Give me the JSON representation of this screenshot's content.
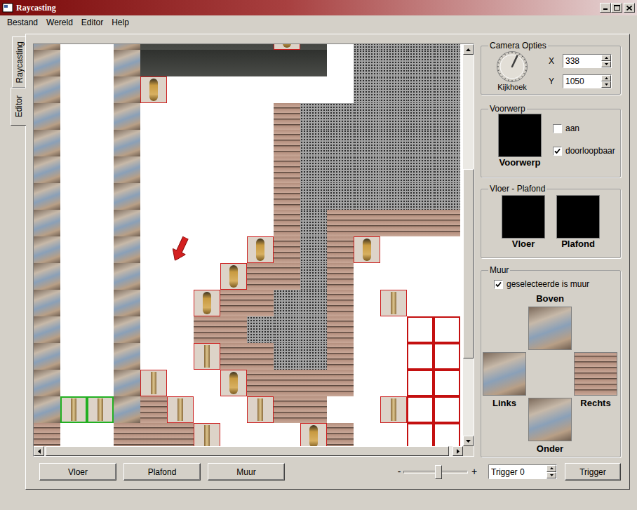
{
  "window": {
    "title": "Raycasting"
  },
  "menu": [
    "Bestand",
    "Wereld",
    "Editor",
    "Help"
  ],
  "side_tabs": [
    {
      "label": "Raycasting",
      "selected": false
    },
    {
      "label": "Editor",
      "selected": true
    }
  ],
  "map": {
    "rows": [
      [
        "mural",
        "empty",
        "empty",
        "mural",
        "dark",
        "dark",
        "dark",
        "dark",
        "dark",
        "statue",
        "dark",
        "empty",
        "granite",
        "granite",
        "granite",
        "granite"
      ],
      [
        "mural",
        "empty",
        "empty",
        "mural",
        "dark",
        "dark",
        "dark",
        "dark",
        "dark",
        "dark",
        "dark",
        "empty",
        "granite",
        "granite",
        "granite",
        "granite"
      ],
      [
        "mural",
        "empty",
        "empty",
        "mural",
        "statue",
        "empty",
        "empty",
        "empty",
        "empty",
        "empty",
        "empty",
        "empty",
        "granite",
        "granite",
        "granite",
        "granite"
      ],
      [
        "mural",
        "empty",
        "empty",
        "mural",
        "empty",
        "empty",
        "empty",
        "empty",
        "empty",
        "brick",
        "granite",
        "granite",
        "granite",
        "granite",
        "granite",
        "granite"
      ],
      [
        "mural",
        "empty",
        "empty",
        "mural",
        "empty",
        "empty",
        "empty",
        "empty",
        "empty",
        "brick",
        "granite",
        "granite",
        "granite",
        "granite",
        "granite",
        "granite"
      ],
      [
        "mural",
        "empty",
        "empty",
        "mural",
        "empty",
        "empty",
        "empty",
        "empty",
        "empty",
        "brick",
        "granite",
        "granite",
        "granite",
        "granite",
        "granite",
        "granite"
      ],
      [
        "mural",
        "empty",
        "empty",
        "mural",
        "empty",
        "empty",
        "empty",
        "empty",
        "empty",
        "brick",
        "granite",
        "granite",
        "granite",
        "granite",
        "granite",
        "granite"
      ],
      [
        "mural",
        "empty",
        "empty",
        "mural",
        "empty",
        "empty",
        "empty",
        "empty",
        "empty",
        "brick",
        "granite",
        "brick",
        "brick",
        "brick",
        "brick",
        "brick"
      ],
      [
        "mural",
        "empty",
        "empty",
        "mural",
        "empty",
        "empty",
        "empty",
        "empty",
        "statue",
        "brick",
        "granite",
        "brick",
        "statue",
        "empty",
        "empty",
        "empty"
      ],
      [
        "mural",
        "empty",
        "empty",
        "mural",
        "empty",
        "empty",
        "empty",
        "statue",
        "brick",
        "brick",
        "granite",
        "brick",
        "empty",
        "empty",
        "empty",
        "empty"
      ],
      [
        "mural",
        "empty",
        "empty",
        "mural",
        "empty",
        "empty",
        "statue",
        "brick",
        "brick",
        "granite",
        "granite",
        "brick",
        "empty",
        "column",
        "empty",
        "empty"
      ],
      [
        "mural",
        "empty",
        "empty",
        "mural",
        "empty",
        "empty",
        "brick",
        "brick",
        "granite",
        "granite",
        "granite",
        "brick",
        "empty",
        "empty",
        "marked",
        "marked"
      ],
      [
        "mural",
        "empty",
        "empty",
        "mural",
        "empty",
        "empty",
        "column",
        "brick",
        "brick",
        "granite",
        "granite",
        "brick",
        "empty",
        "empty",
        "marked",
        "marked"
      ],
      [
        "mural",
        "empty",
        "empty",
        "mural",
        "column",
        "empty",
        "empty",
        "statue",
        "brick",
        "brick",
        "brick",
        "brick",
        "empty",
        "empty",
        "marked",
        "marked"
      ],
      [
        "mural",
        "pillar",
        "pillar",
        "mural",
        "brick",
        "column",
        "empty",
        "empty",
        "column",
        "brick",
        "brick",
        "empty",
        "empty",
        "column",
        "marked",
        "marked"
      ],
      [
        "brick",
        "empty",
        "empty",
        "brick",
        "brick",
        "brick",
        "column",
        "empty",
        "empty",
        "empty",
        "statue",
        "brick",
        "empty",
        "empty",
        "marked",
        "marked"
      ]
    ]
  },
  "bottom_buttons": [
    "Vloer",
    "Plafond",
    "Muur"
  ],
  "zoom": {
    "minus": "-",
    "plus": "+",
    "level": 0.55
  },
  "trigger_spin": {
    "value": "Trigger 0"
  },
  "trigger_button": "Trigger",
  "camera": {
    "title": "Camera Opties",
    "dial_label": "Kijkhoek",
    "dial_level": 0.07,
    "x_label": "X",
    "x_value": "338",
    "y_label": "Y",
    "y_value": "1050"
  },
  "voorwerp": {
    "title": "Voorwerp",
    "image_label": "Voorwerp",
    "checkboxes": [
      {
        "label": "aan",
        "checked": false
      },
      {
        "label": "doorloopbaar",
        "checked": true
      }
    ]
  },
  "vloer_plafond": {
    "title": "Vloer - Plafond",
    "slots": [
      "Vloer",
      "Plafond"
    ]
  },
  "muur": {
    "title": "Muur",
    "checkbox": {
      "label": "geselecteerde is muur",
      "checked": true
    },
    "sides": [
      {
        "label": "Boven",
        "kind": "mural"
      },
      {
        "label": "Links",
        "kind": "mural"
      },
      {
        "label": "Rechts",
        "kind": "brick"
      },
      {
        "label": "Onder",
        "kind": "mural"
      }
    ]
  }
}
